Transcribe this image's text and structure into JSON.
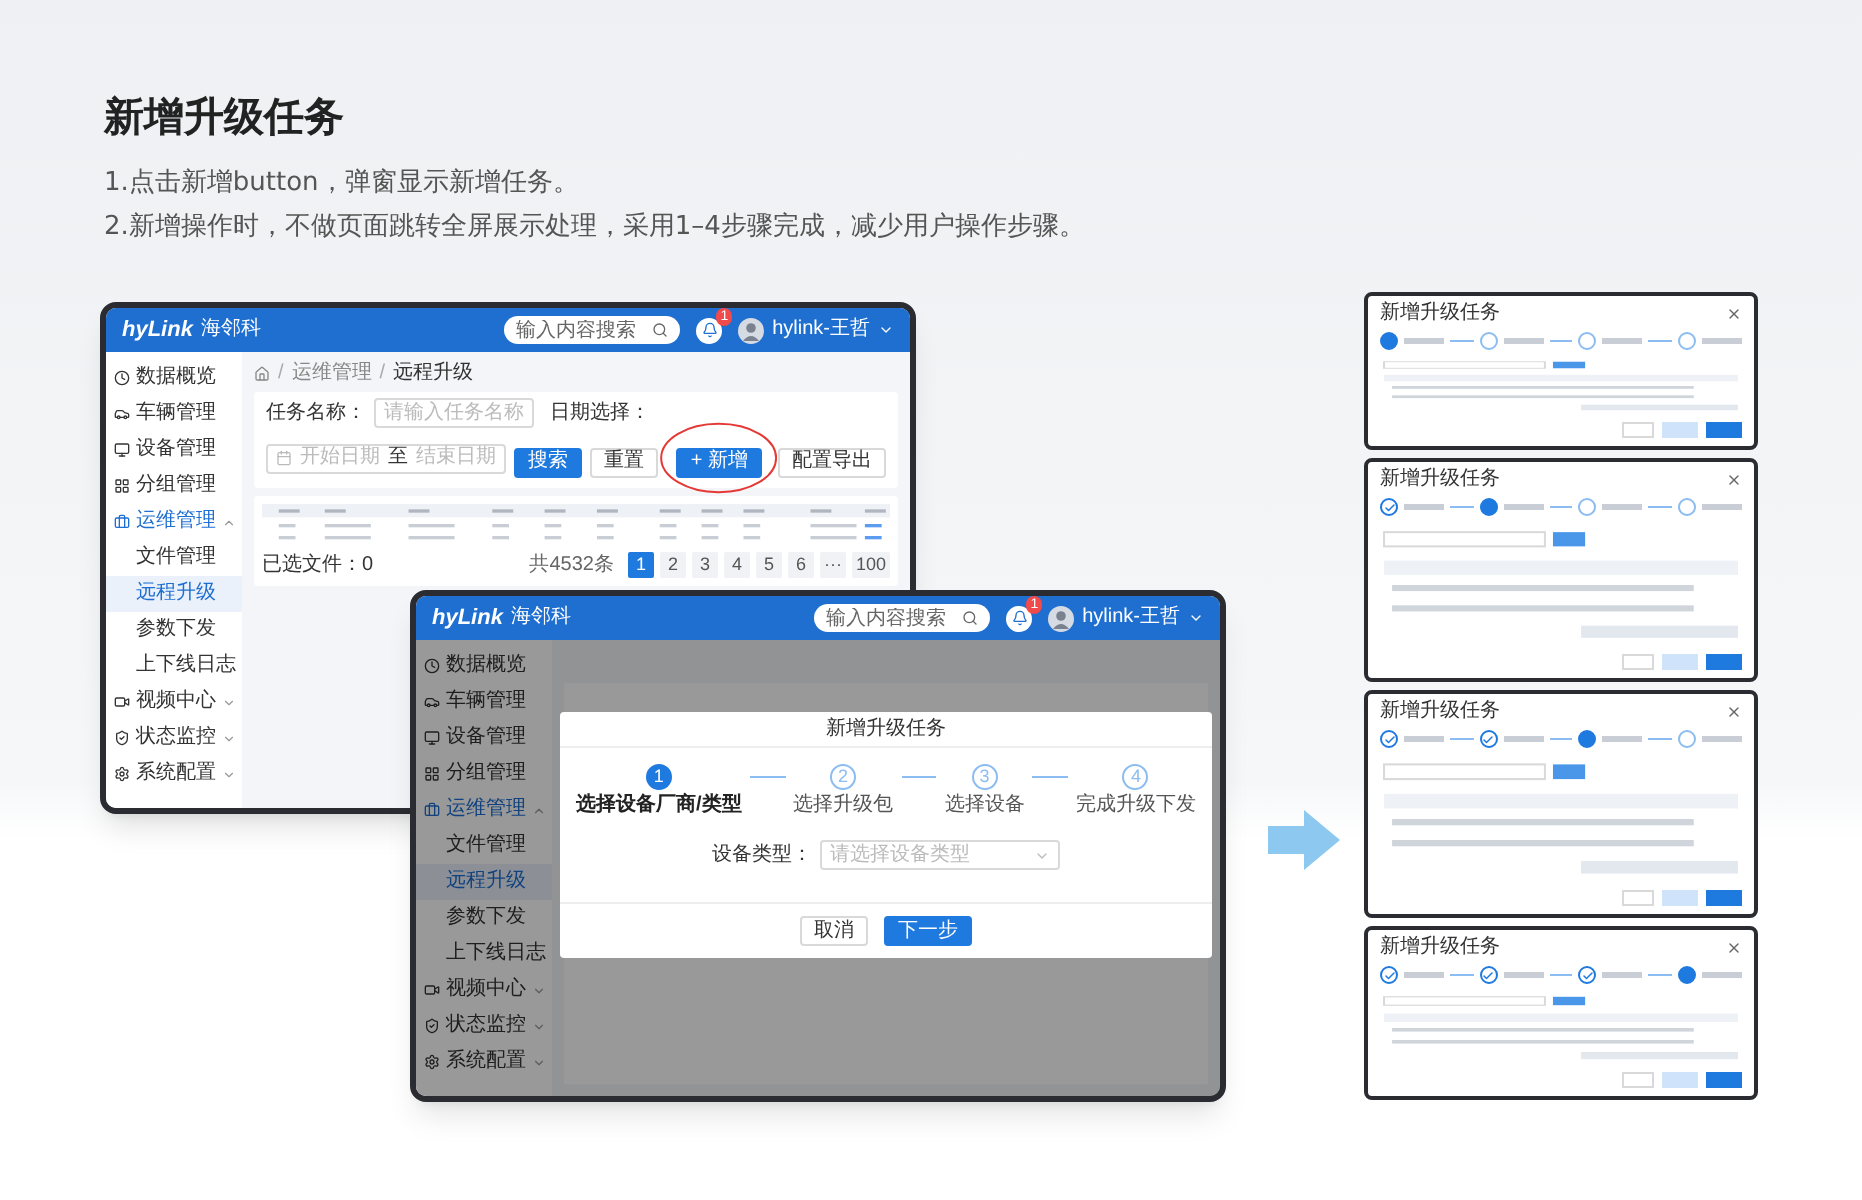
{
  "heading": "新增升级任务",
  "description": [
    "1.点击新增button，弹窗显示新增任务。",
    "2.新增操作时，不做页面跳转全屏展示处理，采用1–4步骤完成，减少用户操作步骤。"
  ],
  "list_window": {
    "logo": "hyLink",
    "logo_cn": "海邻科",
    "search_placeholder": "输入内容搜索",
    "badge": "1",
    "user": "hylink-王哲",
    "menu": [
      {
        "label": "数据概览",
        "selected": false
      },
      {
        "label": "车辆管理",
        "selected": false
      },
      {
        "label": "设备管理",
        "selected": false
      },
      {
        "label": "分组管理",
        "selected": false
      },
      {
        "label": "运维管理",
        "selected": true,
        "expanded": true,
        "children": [
          {
            "label": "文件管理",
            "selected": false
          },
          {
            "label": "远程升级",
            "selected": true
          },
          {
            "label": "参数下发",
            "selected": false
          },
          {
            "label": "上下线日志",
            "selected": false
          }
        ]
      },
      {
        "label": "视频中心",
        "selected": false,
        "expanded": false
      },
      {
        "label": "状态监控",
        "selected": false,
        "expanded": false
      },
      {
        "label": "系统配置",
        "selected": false,
        "expanded": false
      }
    ],
    "breadcrumb": [
      {
        "separator": "/",
        "label": "运维管理"
      },
      {
        "separator": "/",
        "label": "远程升级"
      }
    ],
    "filters": {
      "name_label": "任务名称：",
      "name_placeholder": "请输入任务名称",
      "date_label": "日期选择：",
      "start_placeholder": "开始日期",
      "to": "至",
      "end_placeholder": "结束日期"
    },
    "buttons": [
      {
        "label": "搜索",
        "kind": "primary",
        "highlighted": false
      },
      {
        "label": "重置",
        "kind": "plain",
        "highlighted": false
      },
      {
        "label": "+ 新增",
        "kind": "primary",
        "highlighted": true
      },
      {
        "label": "配置导出",
        "kind": "plain",
        "highlighted": false
      }
    ],
    "selected_files": "已选文件：0",
    "total": "共4532条",
    "pages": [
      {
        "label": "1",
        "selected": true
      },
      {
        "label": "2",
        "selected": false
      },
      {
        "label": "3",
        "selected": false
      },
      {
        "label": "4",
        "selected": false
      },
      {
        "label": "5",
        "selected": false
      },
      {
        "label": "6",
        "selected": false
      },
      {
        "label": "···",
        "selected": false
      },
      {
        "label": "100",
        "selected": false
      }
    ]
  },
  "add_window": {
    "logo": "hyLink",
    "logo_cn": "海邻科",
    "search_placeholder": "输入内容搜索",
    "badge": "1",
    "user": "hylink-王哲",
    "menu": [
      {
        "label": "数据概览",
        "selected": false
      },
      {
        "label": "车辆管理",
        "selected": false
      },
      {
        "label": "设备管理",
        "selected": false
      },
      {
        "label": "分组管理",
        "selected": false
      },
      {
        "label": "运维管理",
        "selected": true,
        "expanded": true,
        "children": [
          {
            "label": "文件管理",
            "selected": false
          },
          {
            "label": "远程升级",
            "selected": true
          },
          {
            "label": "参数下发",
            "selected": false
          },
          {
            "label": "上下线日志",
            "selected": false
          }
        ]
      },
      {
        "label": "视频中心",
        "selected": false,
        "expanded": false
      },
      {
        "label": "状态监控",
        "selected": false,
        "expanded": false
      },
      {
        "label": "系统配置",
        "selected": false,
        "expanded": false
      }
    ],
    "dialog": {
      "title": "新增升级任务",
      "steps": [
        {
          "number": "1",
          "title": "选择设备厂商/类型",
          "selected": true,
          "completed": false
        },
        {
          "number": "2",
          "title": "选择升级包",
          "selected": false,
          "completed": false
        },
        {
          "number": "3",
          "title": "选择设备",
          "selected": false,
          "completed": false
        },
        {
          "number": "4",
          "title": "完成升级下发",
          "selected": false,
          "completed": false
        }
      ],
      "field_label": "设备类型：",
      "field_placeholder": "请选择设备类型",
      "buttons": [
        {
          "label": "取消",
          "kind": "plain"
        },
        {
          "label": "下一步",
          "kind": "primary"
        }
      ]
    }
  },
  "step_dialogs": [
    {
      "title": "新增升级任务",
      "steps": [
        {
          "selected": true,
          "completed": false
        },
        {
          "selected": false,
          "completed": false
        },
        {
          "selected": false,
          "completed": false
        },
        {
          "selected": false,
          "completed": false
        }
      ]
    },
    {
      "title": "新增升级任务",
      "steps": [
        {
          "selected": false,
          "completed": true
        },
        {
          "selected": true,
          "completed": false
        },
        {
          "selected": false,
          "completed": false
        },
        {
          "selected": false,
          "completed": false
        }
      ]
    },
    {
      "title": "新增升级任务",
      "steps": [
        {
          "selected": false,
          "completed": true
        },
        {
          "selected": false,
          "completed": true
        },
        {
          "selected": true,
          "completed": false
        },
        {
          "selected": false,
          "completed": false
        }
      ]
    },
    {
      "title": "新增升级任务",
      "steps": [
        {
          "selected": false,
          "completed": true
        },
        {
          "selected": false,
          "completed": true
        },
        {
          "selected": false,
          "completed": true
        },
        {
          "selected": true,
          "completed": false
        }
      ]
    }
  ]
}
